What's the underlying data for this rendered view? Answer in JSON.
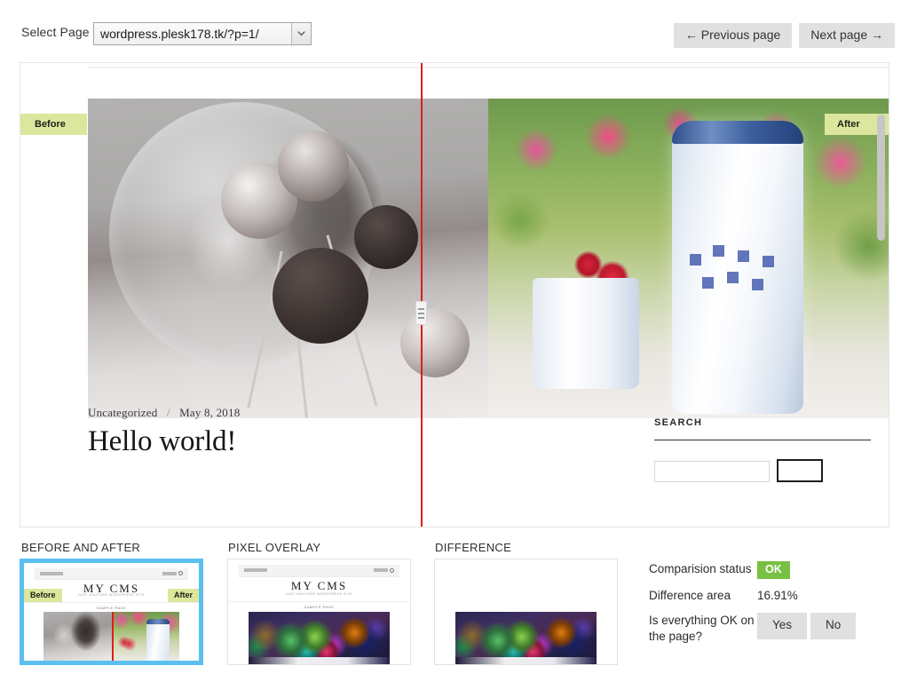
{
  "toolbar": {
    "select_label": "Select Page",
    "selected_page": "wordpress.plesk178.tk/?p=1/",
    "previous_button": "← Previous page",
    "next_button": "Next page →"
  },
  "viewport": {
    "badge_before": "Before",
    "badge_after": "After",
    "post_category": "Uncategorized",
    "post_separator": "/",
    "post_date": "May 8, 2018",
    "post_title": "Hello world!",
    "sidebar_widget_title": "SEARCH"
  },
  "panels": [
    {
      "title": "BEFORE AND AFTER",
      "selected": true
    },
    {
      "title": "PIXEL OVERLAY",
      "selected": false
    },
    {
      "title": "DIFFERENCE",
      "selected": false
    }
  ],
  "thumbnail": {
    "brand": "MY CMS",
    "tagline": "JUST ANOTHER WORDPRESS SITE",
    "nav": "SAMPLE PAGE",
    "badge_before": "Before",
    "badge_after": "After"
  },
  "info": {
    "comparison_status_label": "Comparision status",
    "comparison_status_value": "OK",
    "difference_area_label": "Difference area",
    "difference_area_value": "16.91%",
    "everything_ok_label": "Is everything OK on the page?",
    "yes_button": "Yes",
    "no_button": "No"
  },
  "colors": {
    "status_ok": "#78c043",
    "badge_beige": "#dce69c",
    "selection_blue": "#5bc0f0",
    "divider_red": "#e21b1b",
    "button_grey": "#e0e0e0"
  },
  "icons": {
    "dropdown": "chevron-down-icon",
    "drag": "drag-handle-icon",
    "search": "search-icon"
  }
}
